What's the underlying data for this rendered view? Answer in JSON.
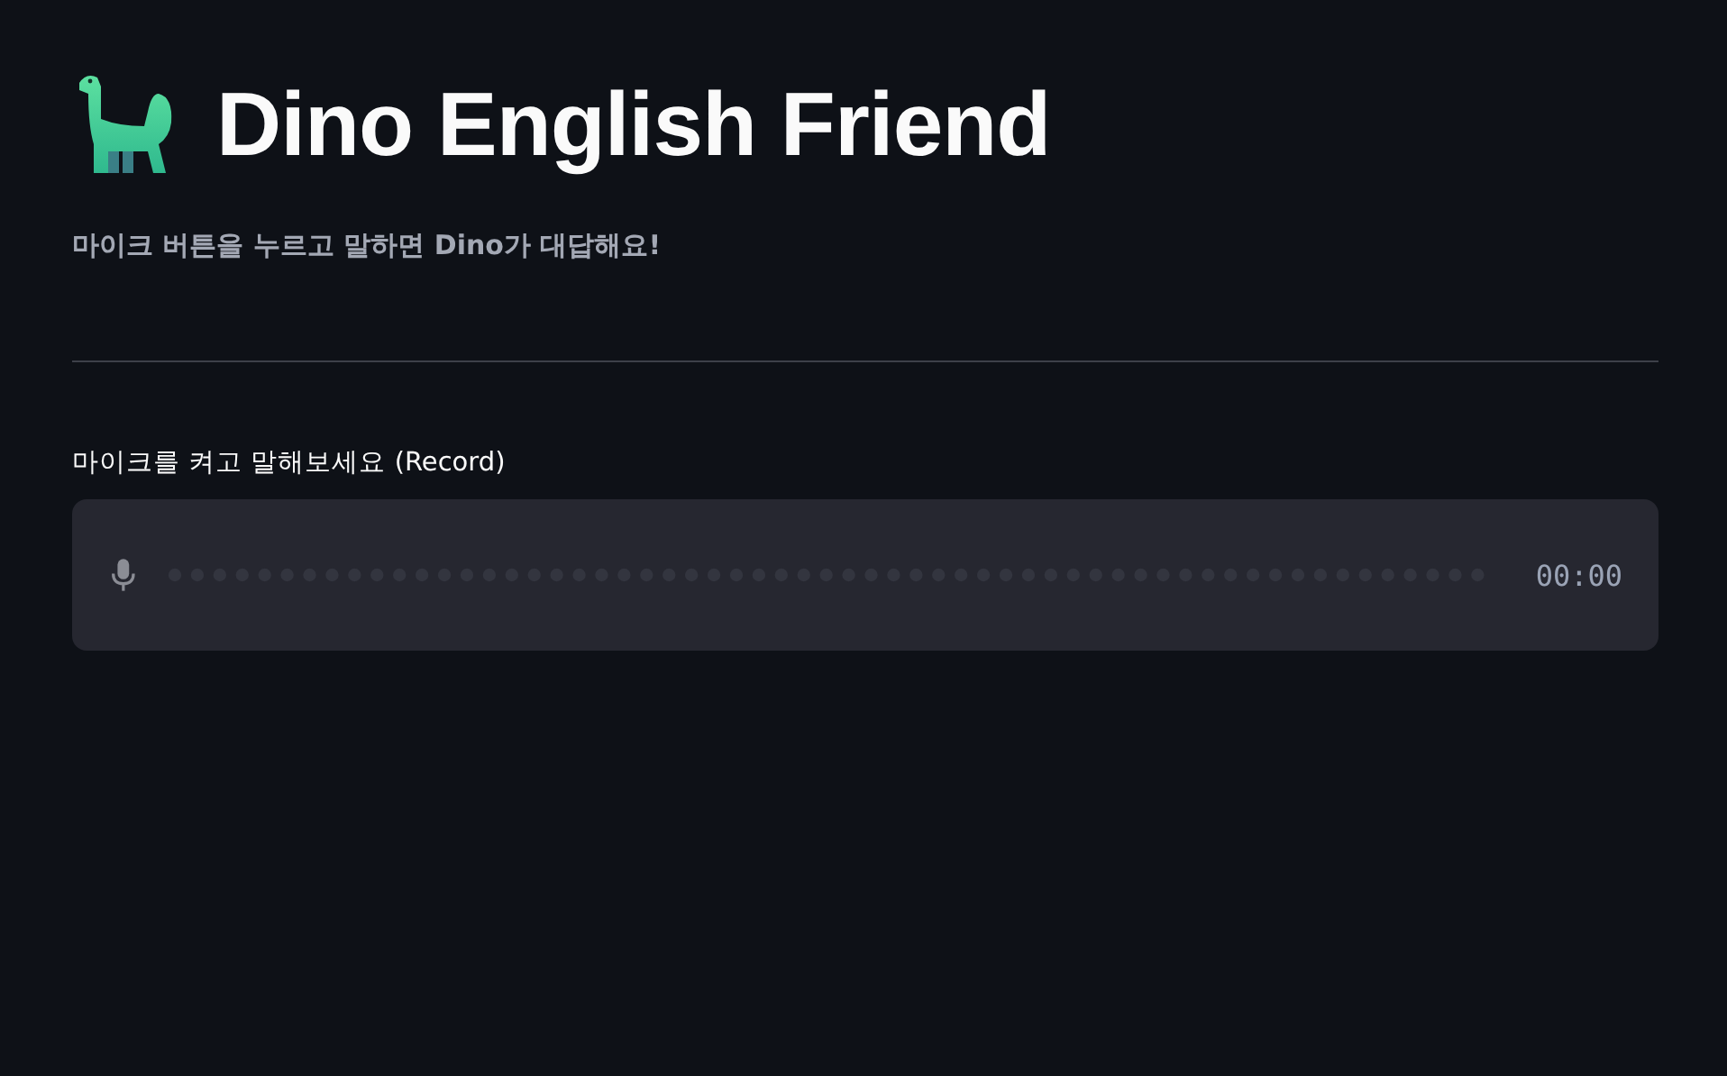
{
  "title": "Dino English Friend",
  "subtitle": "마이크 버튼을 누르고 말하면 Dino가 대답해요!",
  "recorder": {
    "label": "마이크를 켜고 말해보세요 (Record)",
    "time": "00:00"
  }
}
